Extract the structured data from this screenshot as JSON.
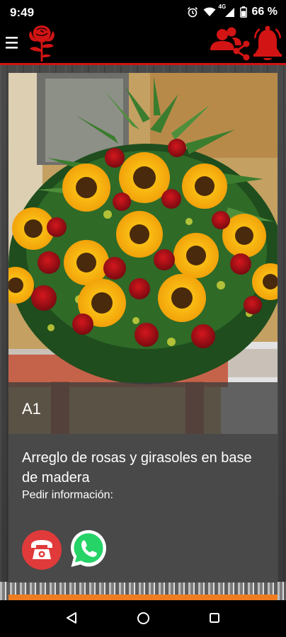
{
  "status_bar": {
    "time": "9:49",
    "battery_percent": "66 %",
    "network_label": "4G",
    "icons": [
      "alarm-icon",
      "wifi-icon",
      "signal-icon",
      "battery-icon"
    ]
  },
  "app_bar": {
    "brand_color": "#d21414",
    "icons": [
      "menu-icon",
      "rose-logo-icon",
      "share-contacts-icon",
      "bell-icon"
    ]
  },
  "product": {
    "code": "A1",
    "description": "Arreglo de rosas y girasoles en base de madera",
    "info_label": "Pedir información:",
    "photo": "sunflower-and-rose-arrangement-photo"
  },
  "actions": {
    "call_icon": "phone-icon",
    "call_color": "#e03a3a",
    "whatsapp_icon": "whatsapp-icon",
    "whatsapp_color": "#25d366"
  },
  "nav_bar": {
    "icons": [
      "back-icon",
      "home-icon",
      "recents-icon"
    ]
  }
}
